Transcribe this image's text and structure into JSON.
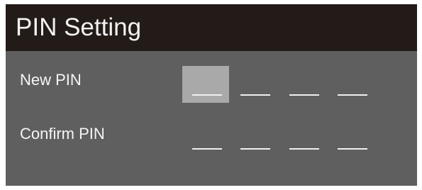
{
  "dialog": {
    "title": "PIN Setting"
  },
  "fields": {
    "new_pin": {
      "label": "New PIN",
      "digits": [
        "",
        "",
        "",
        ""
      ],
      "focused_index": 0
    },
    "confirm_pin": {
      "label": "Confirm PIN",
      "digits": [
        "",
        "",
        "",
        ""
      ]
    }
  },
  "colors": {
    "title_bar": "#231b17",
    "panel": "#5f5f5f",
    "focus_highlight": "#a9a9a9",
    "text": "#f5f5f5"
  }
}
